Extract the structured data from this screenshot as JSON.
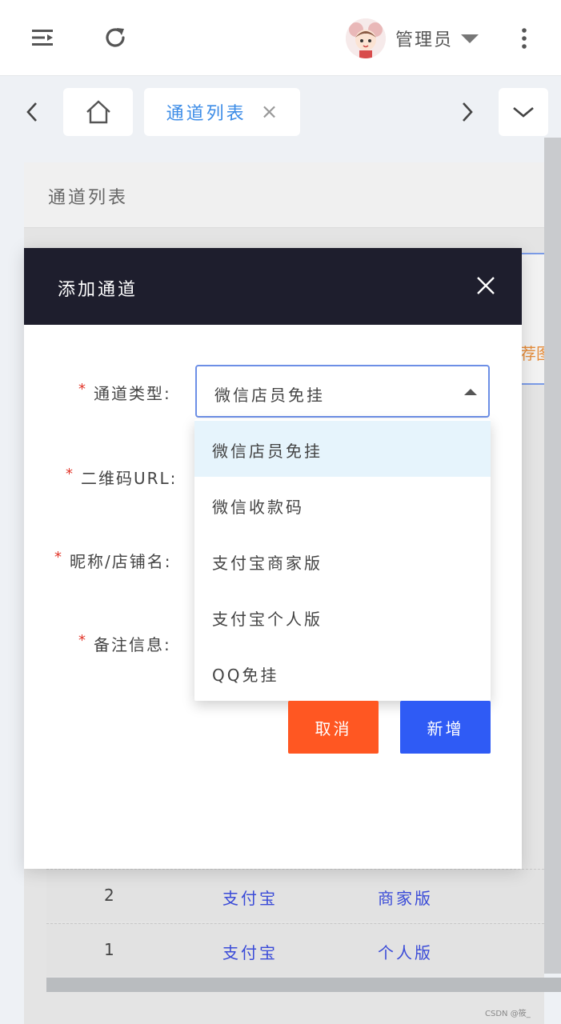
{
  "header": {
    "user_name": "管理员"
  },
  "tabs": {
    "current_label": "通道列表"
  },
  "page": {
    "title": "通道列表",
    "bg_strip_text": "荐图"
  },
  "table": {
    "rows": [
      {
        "id": "2",
        "type": "支付宝",
        "version": "商家版"
      },
      {
        "id": "1",
        "type": "支付宝",
        "version": "个人版"
      }
    ]
  },
  "modal": {
    "title": "添加通道",
    "fields": {
      "channel_type_label": "通道类型:",
      "qrcode_label": "二维码URL:",
      "nickname_label": "昵称/店铺名:",
      "remark_label": "备注信息:"
    },
    "required_mark": "*",
    "select_value": "微信店员免挂",
    "options": [
      "微信店员免挂",
      "微信收款码",
      "支付宝商家版",
      "支付宝个人版",
      "QQ免挂"
    ],
    "cancel_label": "取消",
    "add_label": "新增"
  },
  "watermark": "CSDN @筱_",
  "colors": {
    "header_dark": "#1e1e2d",
    "cancel": "#ff5722",
    "primary": "#2f5bf5",
    "tab_text": "#3c8ce7",
    "required": "#e2362a"
  }
}
